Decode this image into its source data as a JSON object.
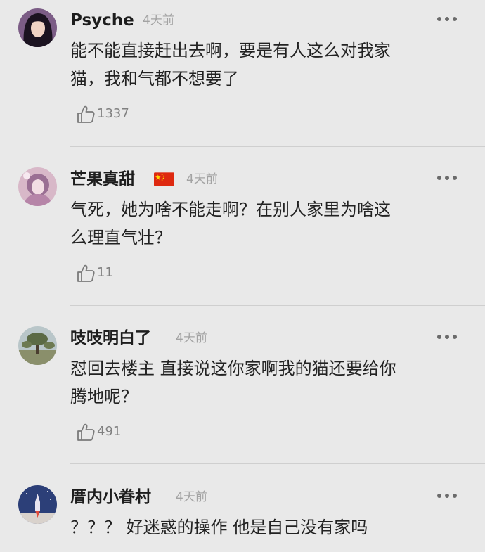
{
  "comments": [
    {
      "username": "Psyche",
      "time": "4天前",
      "text_lines": [
        "能不能直接赶出去啊，要是有人这么对我家",
        "猫，我和气都不想要了"
      ],
      "likes": "1337",
      "avatar_icon": "portrait-woman-dark-hair"
    },
    {
      "username": "芒果真甜",
      "flag_icon": "china-flag-icon",
      "time": "4天前",
      "text_lines": [
        "气死，她为啥不能走啊？在别人家里为啥这",
        "么理直气壮？"
      ],
      "likes": "11",
      "avatar_icon": "portrait-pink-anime"
    },
    {
      "username": "吱吱明白了",
      "time": "4天前",
      "text_lines": [
        "怼回去楼主 直接说这你家啊我的猫还要给你",
        "腾地呢？"
      ],
      "likes": "491",
      "avatar_icon": "landscape-tree"
    },
    {
      "username": "厝内小眷村",
      "time": "4天前",
      "text_lines": [
        "？？？ 好迷惑的操作 他是自己没有家吗"
      ],
      "avatar_icon": "rocket-launch"
    }
  ],
  "icons": {
    "more": "more-dots-icon",
    "like": "thumbs-up-icon"
  },
  "colors": {
    "background": "#e9e9e9",
    "username": "#1d1d1d",
    "meta": "#a3a3a3",
    "body_text": "#222222",
    "like_count": "#808080"
  }
}
